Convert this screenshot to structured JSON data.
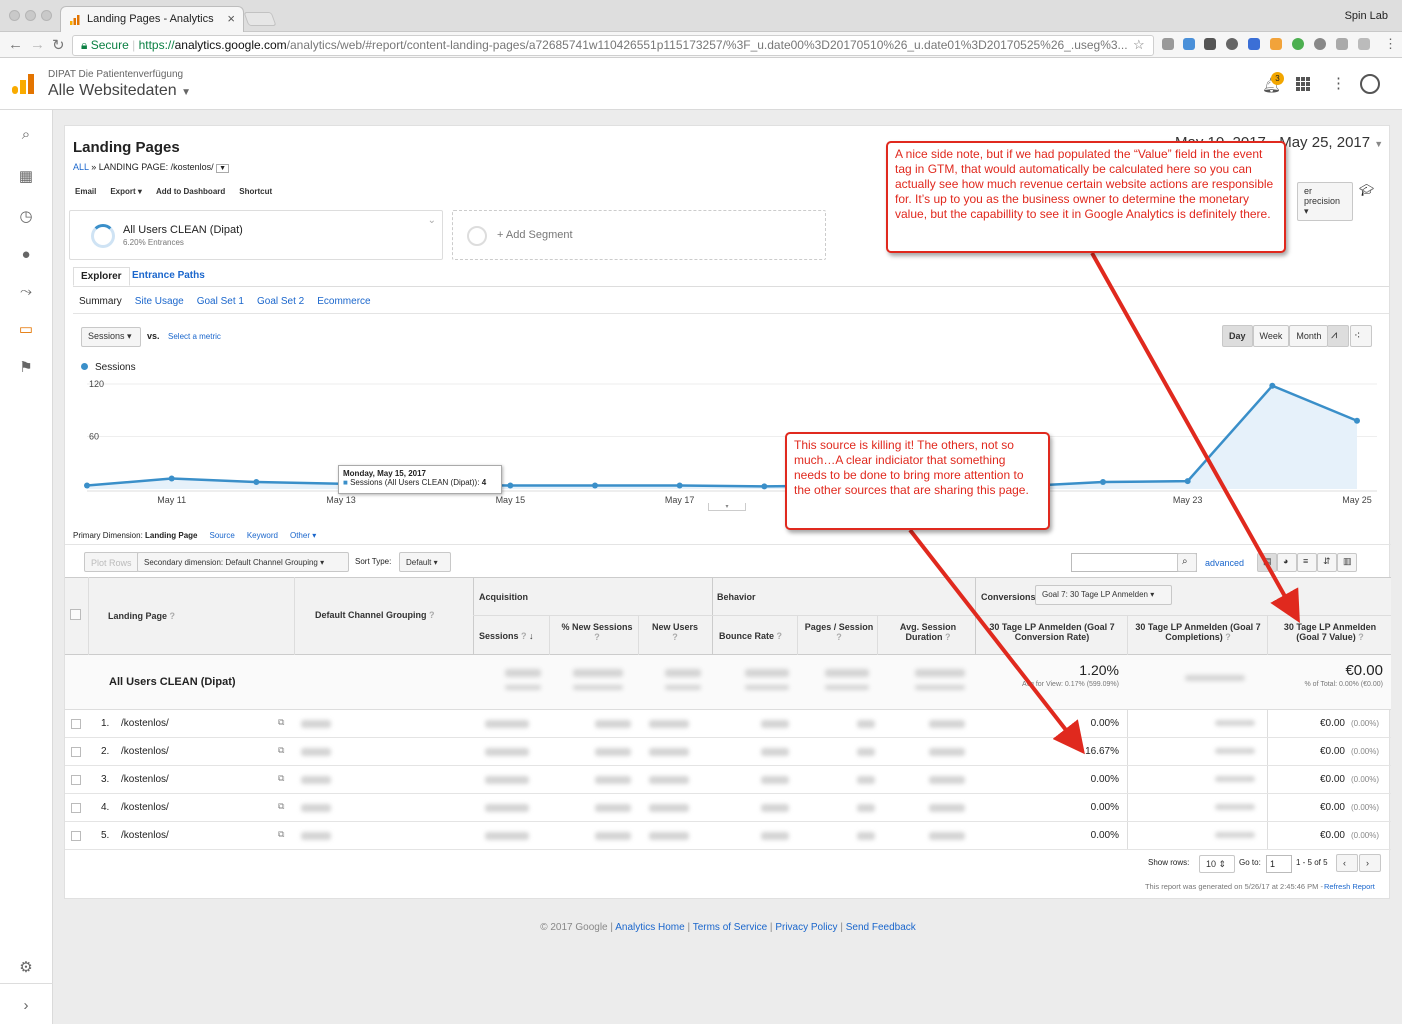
{
  "browser": {
    "tab_title": "Landing Pages - Analytics",
    "profile": "Spin Lab",
    "secure_label": "Secure",
    "url_scheme": "https://",
    "url_host": "analytics.google.com",
    "url_path": "/analytics/web/#report/content-landing-pages/a72685741w110426551p115173257/%3F_u.date00%3D20170510%26_u.date01%3D20170525%26_.useg%3..."
  },
  "ga": {
    "account": "DIPAT Die Patientenverfügung",
    "property": "Alle Websitedaten",
    "notification_count": "3"
  },
  "report": {
    "title": "Landing Pages",
    "breadcrumb_all": "ALL",
    "breadcrumb_sep": "»",
    "breadcrumb_path": "LANDING PAGE: /kostenlos/",
    "date_range": "May 10, 2017 - May 25, 2017",
    "actions": [
      "Email",
      "Export",
      "Add to Dashboard",
      "Shortcut"
    ],
    "precision": "er precision",
    "segment_name": "All Users CLEAN (Dipat)",
    "segment_sub": "6.20% Entrances",
    "add_segment": "+ Add Segment",
    "tabs": [
      "Explorer",
      "Entrance Paths"
    ],
    "subtabs": [
      "Summary",
      "Site Usage",
      "Goal Set 1",
      "Goal Set 2",
      "Ecommerce"
    ],
    "metric_select": "Sessions",
    "vs": "vs.",
    "select_metric": "Select a metric",
    "period_buttons": [
      "Day",
      "Week",
      "Month"
    ],
    "legend": "Sessions"
  },
  "chart_data": {
    "type": "line",
    "series": [
      {
        "name": "Sessions",
        "values": [
          4,
          12,
          8,
          6,
          5,
          4,
          4,
          4,
          3,
          4,
          3,
          3,
          8,
          9,
          118,
          78
        ]
      }
    ],
    "x": [
      "May 10",
      "May 11",
      "May 12",
      "May 13",
      "May 14",
      "May 15",
      "May 16",
      "May 17",
      "May 18",
      "May 19",
      "May 20",
      "May 21",
      "May 22",
      "May 23",
      "May 24",
      "May 25"
    ],
    "x_tick_labels": [
      "May 11",
      "May 13",
      "May 15",
      "May 17",
      "May 23",
      "May 25"
    ],
    "y_tick_labels": [
      "120",
      "60"
    ],
    "ylim": [
      0,
      120
    ],
    "tooltip_title": "Monday, May 15, 2017",
    "tooltip_text": "Sessions (All Users CLEAN (Dipat)):",
    "tooltip_value": "4",
    "color": "#3a8fc9"
  },
  "table": {
    "primary_dim_label": "Primary Dimension:",
    "primary_dims": [
      "Landing Page",
      "Source",
      "Keyword",
      "Other"
    ],
    "plot_rows": "Plot Rows",
    "secondary_dim": "Secondary dimension: Default Channel Grouping",
    "sort_type_label": "Sort Type:",
    "sort_type": "Default",
    "advanced": "advanced",
    "col_landing": "Landing Page",
    "col_channel": "Default Channel Grouping",
    "group_acq": "Acquisition",
    "group_beh": "Behavior",
    "group_conv": "Conversions",
    "goal_select": "Goal 7: 30 Tage LP Anmelden",
    "col_sessions": "Sessions",
    "col_new_sessions": "% New Sessions",
    "col_new_users": "New Users",
    "col_bounce": "Bounce Rate",
    "col_pages": "Pages / Session",
    "col_duration": "Avg. Session Duration",
    "col_conv_rate": "30 Tage LP Anmelden (Goal 7 Conversion Rate)",
    "col_completions": "30 Tage LP Anmelden (Goal 7 Completions)",
    "col_value": "30 Tage LP Anmelden (Goal 7 Value)",
    "total_label": "All Users CLEAN (Dipat)",
    "total_conv_rate": "1.20%",
    "total_conv_sub": "Avg for View: 0.17% (599.09%)",
    "total_value": "€0.00",
    "total_value_sub": "% of Total: 0.00% (€0.00)",
    "rows": [
      {
        "num": "1.",
        "page": "/kostenlos/",
        "conv": "0.00%",
        "value": "€0.00",
        "pct": "(0.00%)"
      },
      {
        "num": "2.",
        "page": "/kostenlos/",
        "conv": "16.67%",
        "value": "€0.00",
        "pct": "(0.00%)"
      },
      {
        "num": "3.",
        "page": "/kostenlos/",
        "conv": "0.00%",
        "value": "€0.00",
        "pct": "(0.00%)"
      },
      {
        "num": "4.",
        "page": "/kostenlos/",
        "conv": "0.00%",
        "value": "€0.00",
        "pct": "(0.00%)"
      },
      {
        "num": "5.",
        "page": "/kostenlos/",
        "conv": "0.00%",
        "value": "€0.00",
        "pct": "(0.00%)"
      }
    ],
    "show_rows_label": "Show rows:",
    "show_rows": "10",
    "goto_label": "Go to:",
    "goto": "1",
    "range": "1 - 5 of 5",
    "generated": "This report was generated on 5/26/17 at 2:45:46 PM -",
    "refresh": "Refresh Report"
  },
  "annotations": {
    "note1": "A nice side note, but if we had populated the “Value” field in the event tag in GTM, that would automatically be calculated here so you can actually see how much revenue certain website actions are responsible for. It’s up to you as the business owner to determine the monetary value, but the capabillity to see it in Google Analytics is definitely there.",
    "note2": "This source is killing it! The others, not so much…A clear indiciator that something needs to be done to bring more attention to the other sources that are sharing this page."
  },
  "footer": {
    "copyright": "© 2017 Google |",
    "links": [
      "Analytics Home",
      "Terms of Service",
      "Privacy Policy",
      "Send Feedback"
    ]
  }
}
